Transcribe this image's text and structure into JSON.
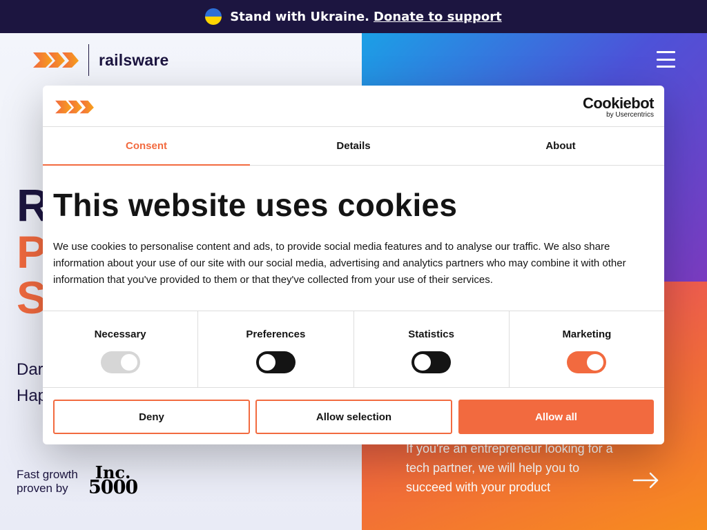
{
  "banner": {
    "text": "Stand with Ukraine.",
    "link": "Donate to support"
  },
  "header": {
    "brand": "railsware"
  },
  "hero": {
    "letters": [
      "R",
      "P",
      "S"
    ],
    "sub_lines": [
      "Dar",
      "Hap"
    ]
  },
  "growth": {
    "line1": "Fast growth",
    "line2": "proven by",
    "inc_top": "Inc.",
    "inc_bottom": "5000"
  },
  "promo": {
    "text": "If you're an entrepreneur looking for a tech partner, we will help you to succeed with your product"
  },
  "cookie_dialog": {
    "brand_name": "Cookiebot",
    "brand_by": "by Usercentrics",
    "tabs": [
      "Consent",
      "Details",
      "About"
    ],
    "active_tab": "Consent",
    "title": "This website uses cookies",
    "body": "We use cookies to personalise content and ads, to provide social media features and to analyse our traffic. We also share information about your use of our site with our social media, advertising and analytics partners who may combine it with other information that you've provided to them or that they've collected from your use of their services.",
    "categories": [
      {
        "label": "Necessary",
        "state": "on-disabled"
      },
      {
        "label": "Preferences",
        "state": "off"
      },
      {
        "label": "Statistics",
        "state": "off"
      },
      {
        "label": "Marketing",
        "state": "on"
      }
    ],
    "buttons": {
      "deny": "Deny",
      "allow_selection": "Allow selection",
      "allow_all": "Allow all"
    }
  },
  "colors": {
    "accent": "#f26a3f",
    "navy": "#1c1540"
  }
}
